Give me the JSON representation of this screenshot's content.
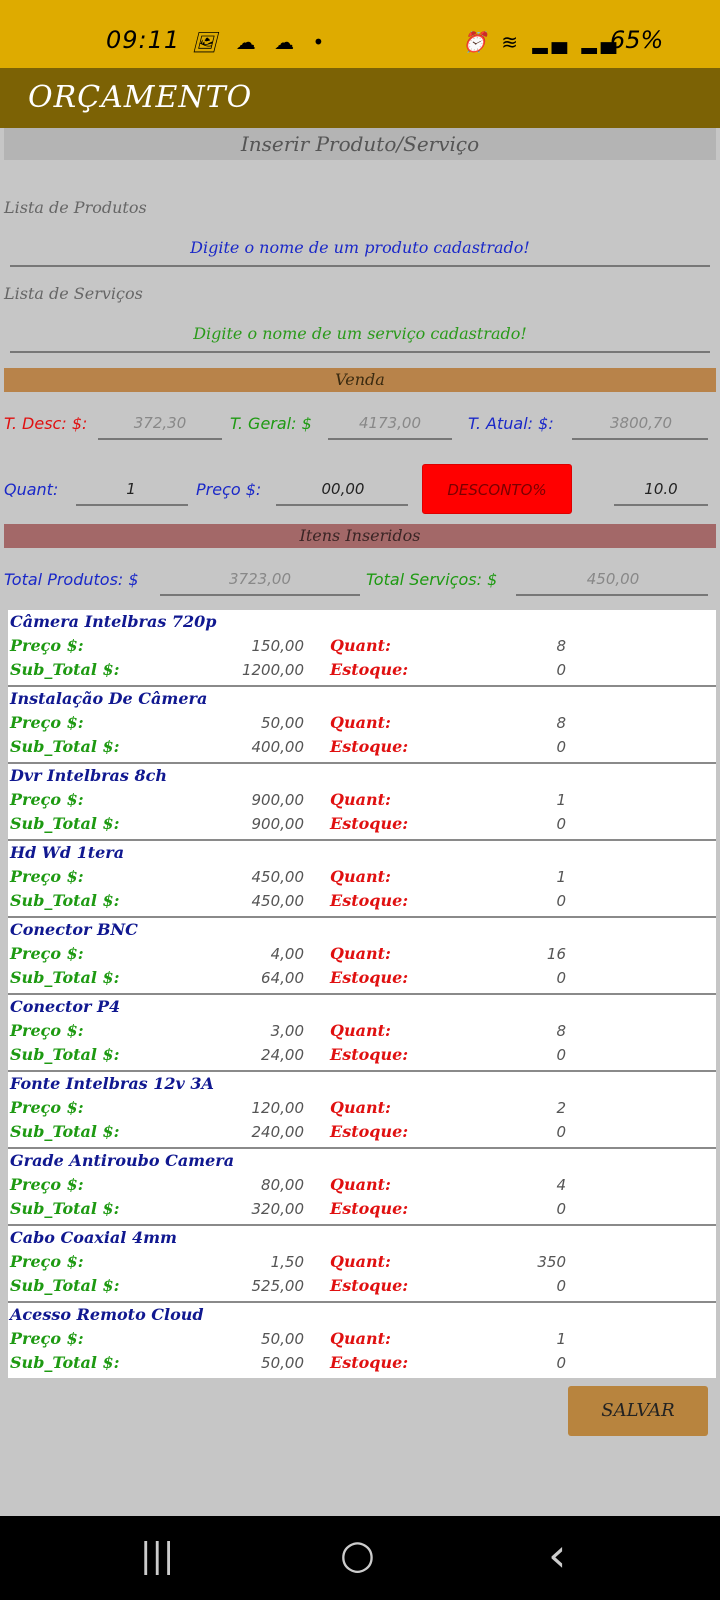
{
  "status": {
    "time": "09:11",
    "icons_left": "🖼 ☁ ☁ •",
    "icons_right": "⏰ ≋ ▂▄ ▂▄",
    "battery": "65%"
  },
  "app": {
    "title": "ORÇAMENTO"
  },
  "insert": {
    "title": "Inserir Produto/Serviço",
    "products_label": "Lista de Produtos",
    "products_placeholder": "Digite o nome de um produto cadastrado!",
    "services_label": "Lista de Serviços",
    "services_placeholder": "Digite o nome de um serviço cadastrado!"
  },
  "venda": {
    "title": "Venda",
    "t_desc_label": "T. Desc: $:",
    "t_desc_value": "372,30",
    "t_geral_label": "T. Geral: $",
    "t_geral_value": "4173,00",
    "t_atual_label": "T. Atual: $:",
    "t_atual_value": "3800,70",
    "quant_label": "Quant:",
    "quant_value": "1",
    "preco_label": "Preço $:",
    "preco_value": "00,00",
    "desconto_button": "DESCONTO%",
    "desconto_value": "10.0"
  },
  "itens": {
    "title": "Itens Inseridos",
    "total_produtos_label": "Total Produtos: $",
    "total_produtos_value": "3723,00",
    "total_servicos_label": "Total Serviços: $",
    "total_servicos_value": "450,00"
  },
  "labels": {
    "preco": "Preço $:",
    "subtotal": "Sub_Total $:",
    "quant": "Quant:",
    "estoque": "Estoque:"
  },
  "items": [
    {
      "name": "Câmera Intelbras 720p",
      "preco": "150,00",
      "subtotal": "1200,00",
      "quant": "8",
      "estoque": "0"
    },
    {
      "name": "Instalação De Câmera",
      "preco": "50,00",
      "subtotal": "400,00",
      "quant": "8",
      "estoque": "0"
    },
    {
      "name": "Dvr Intelbras 8ch",
      "preco": "900,00",
      "subtotal": "900,00",
      "quant": "1",
      "estoque": "0"
    },
    {
      "name": "Hd Wd 1tera",
      "preco": "450,00",
      "subtotal": "450,00",
      "quant": "1",
      "estoque": "0"
    },
    {
      "name": "Conector BNC",
      "preco": "4,00",
      "subtotal": "64,00",
      "quant": "16",
      "estoque": "0"
    },
    {
      "name": "Conector P4",
      "preco": "3,00",
      "subtotal": "24,00",
      "quant": "8",
      "estoque": "0"
    },
    {
      "name": "Fonte Intelbras 12v 3A",
      "preco": "120,00",
      "subtotal": "240,00",
      "quant": "2",
      "estoque": "0"
    },
    {
      "name": "Grade Antiroubo Camera",
      "preco": "80,00",
      "subtotal": "320,00",
      "quant": "4",
      "estoque": "0"
    },
    {
      "name": "Cabo Coaxial 4mm",
      "preco": "1,50",
      "subtotal": "525,00",
      "quant": "350",
      "estoque": "0"
    },
    {
      "name": "Acesso Remoto Cloud",
      "preco": "50,00",
      "subtotal": "50,00",
      "quant": "1",
      "estoque": "0"
    }
  ],
  "actions": {
    "save": "SALVAR"
  },
  "nav": {
    "recents": "|||",
    "home": "○",
    "back": "‹"
  }
}
